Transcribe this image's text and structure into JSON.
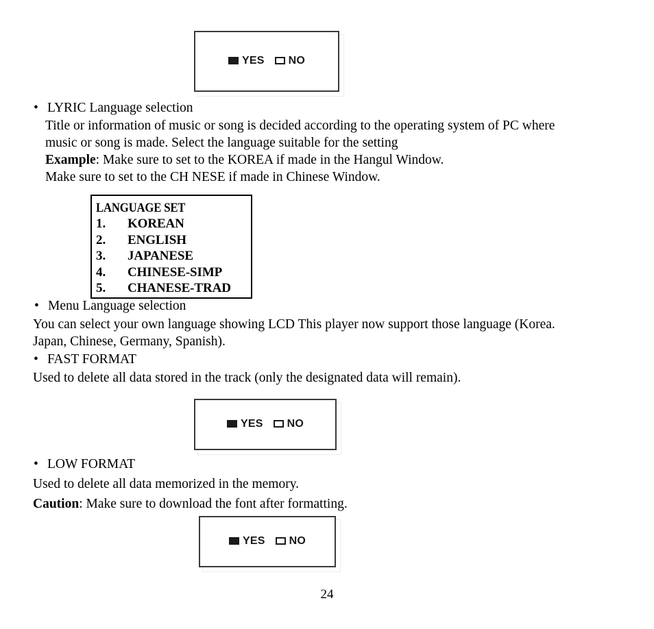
{
  "document": {
    "page_number": "24"
  },
  "dialogs": {
    "yes_label": "YES",
    "no_label": "NO",
    "lyric_dialog_name": "lyric-language-yes-no-dialog",
    "fast_format_dialog_name": "fast-format-yes-no-dialog",
    "low_format_dialog_name": "low-format-yes-no-dialog"
  },
  "sections": {
    "lyric": {
      "heading": "LYRIC Language selection",
      "paragraph": "Title or information of music or song is decided according to the operating system of PC where",
      "paragraph_last_line": "music or song is made. Select the language suitable for the setting",
      "example_label": "Example",
      "example_text": ": Make sure to set to the KOREA if made in the Hangul Window.",
      "example_line2": "Make sure to set to the CH NESE if made in Chinese Window."
    },
    "language_set": {
      "title": "LANGUAGE SET",
      "items": [
        {
          "number": "1.",
          "name": "KOREAN"
        },
        {
          "number": "2.",
          "name": "ENGLISH"
        },
        {
          "number": "3.",
          "name": "JAPANESE"
        },
        {
          "number": "4.",
          "name": "CHINESE-SIMP"
        },
        {
          "number": "5.",
          "name": "CHANESE-TRAD"
        }
      ]
    },
    "menu_language": {
      "heading": "Menu Language selection",
      "paragraph": "You can select your own language showing LCD This player now support those language (Korea.",
      "paragraph_last_line": "Japan, Chinese, Germany, Spanish)."
    },
    "fast_format": {
      "heading": "FAST FORMAT",
      "paragraph": "Used to delete all data stored in the track (only the designated data will remain)."
    },
    "low_format": {
      "heading": "LOW FORMAT",
      "paragraph": "Used to delete all data memorized in the memory.",
      "caution_label": "Caution",
      "caution_text": ": Make sure to download the font after formatting."
    }
  },
  "colors": {
    "text": "#000000",
    "lcd_border": "#3a3a3c",
    "lcd_glyph": "#1a1a1a",
    "menu_box_border": "#000000"
  }
}
